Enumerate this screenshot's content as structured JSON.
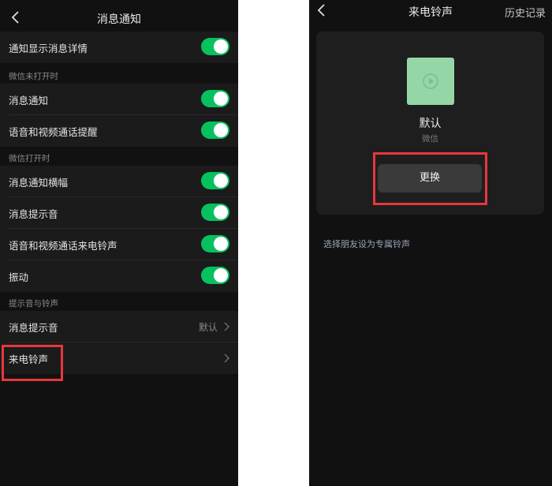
{
  "left": {
    "title": "消息通知",
    "rows": [
      {
        "label": "通知显示消息详情"
      }
    ],
    "group_closed": {
      "label": "微信未打开时",
      "rows": [
        {
          "label": "消息通知"
        },
        {
          "label": "语音和视频通话提醒"
        }
      ]
    },
    "group_open": {
      "label": "微信打开时",
      "rows": [
        {
          "label": "消息通知横幅"
        },
        {
          "label": "消息提示音"
        },
        {
          "label": "语音和视频通话来电铃声"
        },
        {
          "label": "振动"
        }
      ]
    },
    "group_sound": {
      "label": "提示音与铃声",
      "rows": [
        {
          "label": "消息提示音",
          "value": "默认"
        },
        {
          "label": "来电铃声"
        }
      ]
    }
  },
  "right": {
    "title": "来电铃声",
    "history": "历史记录",
    "ringtone_name": "默认",
    "ringtone_source": "微信",
    "change_label": "更换",
    "friend_link": "选择朋友设为专属铃声"
  },
  "colors": {
    "toggle_on": "#07c160",
    "highlight": "#e8373c",
    "cover": "#95d6a6"
  },
  "icons": {
    "back": "chevron-left-icon",
    "arrow": "chevron-right-icon",
    "play": "play-icon"
  }
}
